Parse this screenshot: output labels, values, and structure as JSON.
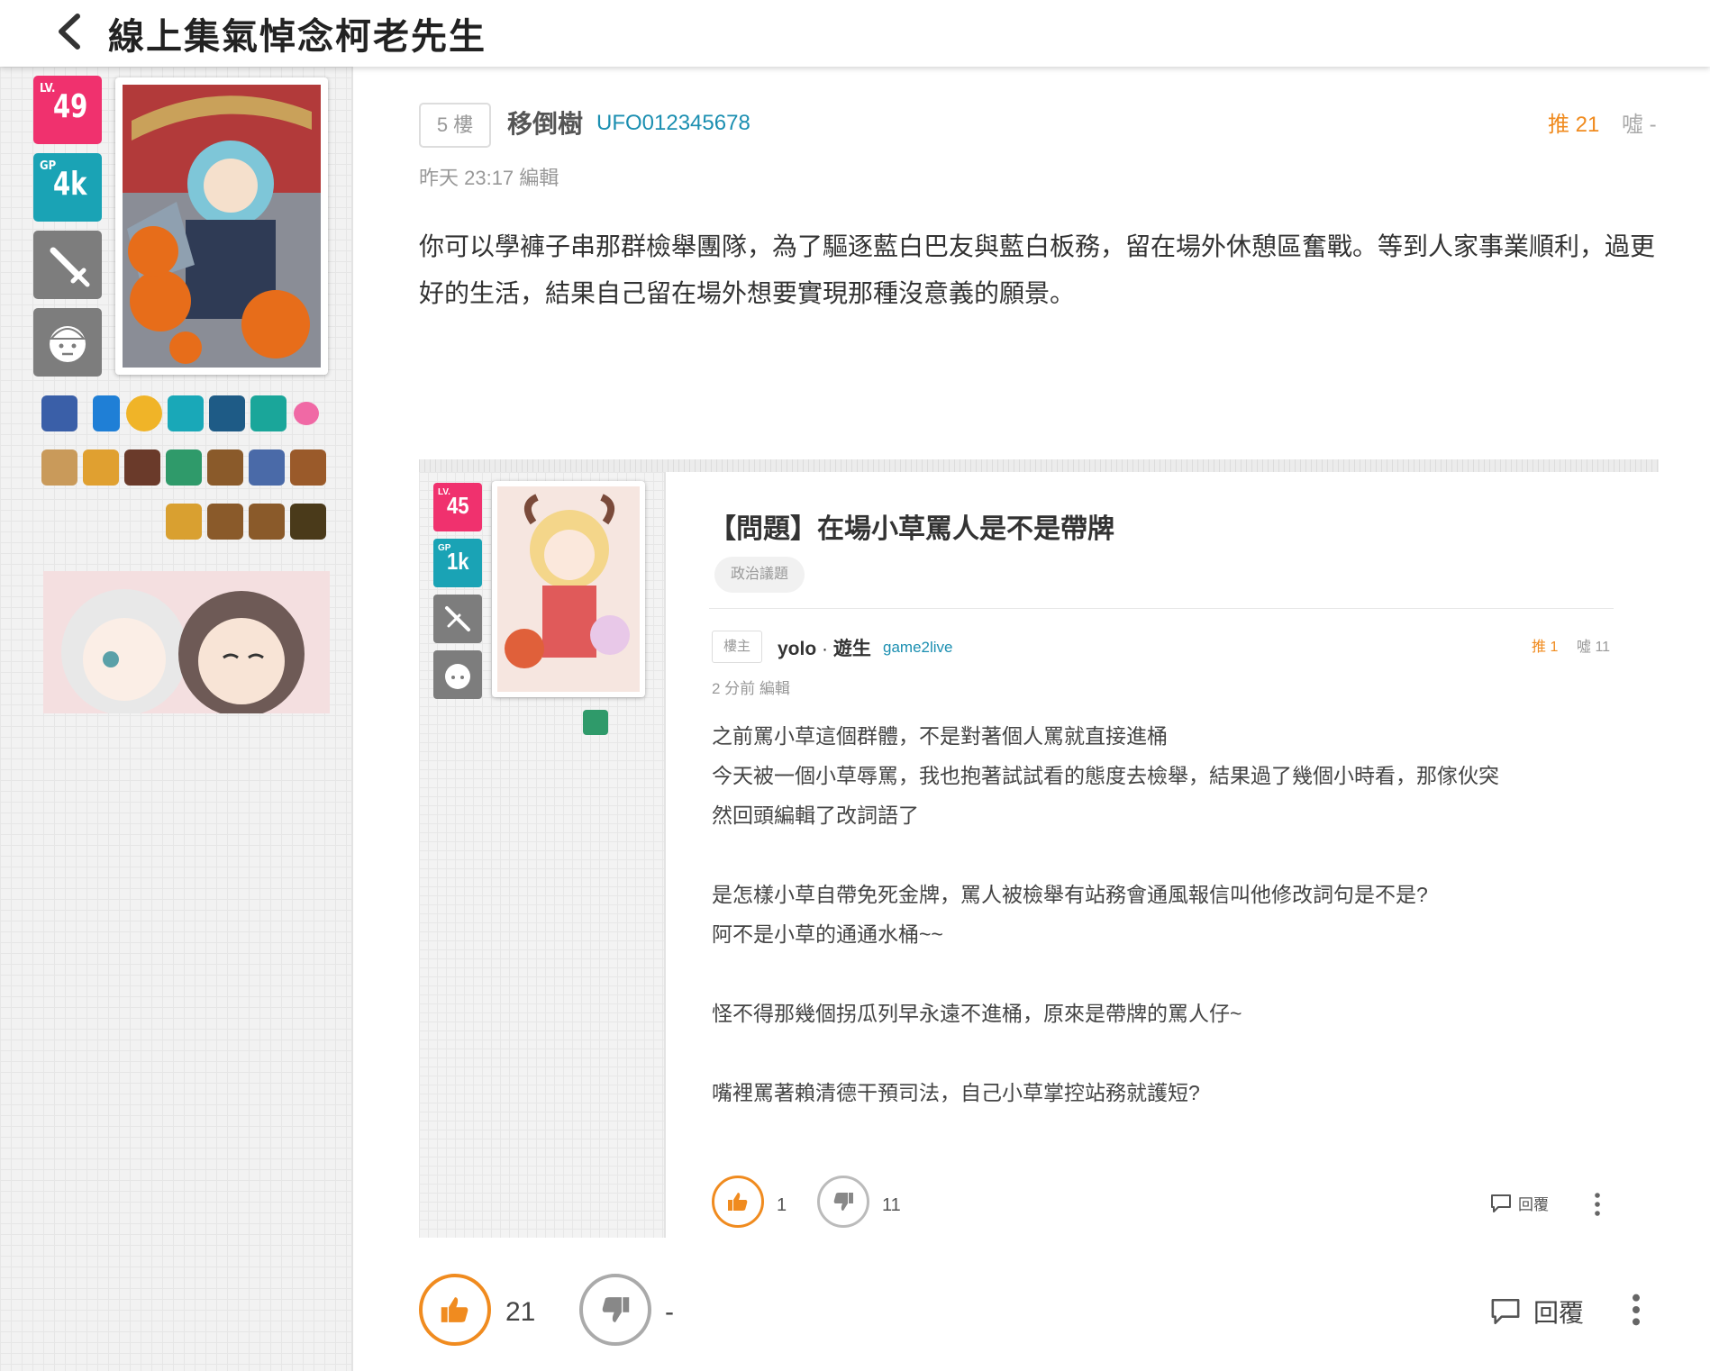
{
  "header": {
    "title": "線上集氣悼念柯老先生"
  },
  "sidebar": {
    "level": {
      "label": "LV.",
      "value": "49"
    },
    "gp": {
      "label": "GP",
      "value": "4k"
    }
  },
  "post": {
    "floor": "5 樓",
    "author": "移倒樹",
    "user_id": "UFO012345678",
    "push": "推 21",
    "boo": "噓 -",
    "meta": "昨天 23:17 編輯",
    "body": "你可以學褲子串那群檢舉團隊，為了驅逐藍白巴友與藍白板務，留在場外休憩區奮戰。等到人家事業順利，過更好的生活，結果自己留在場外想要實現那種沒意義的願景。",
    "like_count": "21",
    "dislike_count": "-",
    "reply_label": "回覆"
  },
  "quote": {
    "level": {
      "label": "LV.",
      "value": "45"
    },
    "gp": {
      "label": "GP",
      "value": "1k"
    },
    "title": "【問題】在場小草罵人是不是帶牌",
    "chip": "政治議題",
    "floor": "樓主",
    "author_name": "yolo",
    "author_sep": " · ",
    "author_nick": "遊生",
    "user_id": "game2live",
    "push": "推 1",
    "boo": "噓 11",
    "meta": "2 分前 編輯",
    "lines": [
      "之前罵小草這個群體，不是對著個人罵就直接進桶",
      "今天被一個小草辱罵，我也抱著試試看的態度去檢舉，結果過了幾個小時看，那傢伙突",
      "然回頭編輯了改詞語了",
      "",
      "是怎樣小草自帶免死金牌，罵人被檢舉有站務會通風報信叫他修改詞句是不是?",
      "阿不是小草的通通水桶~~",
      "",
      "怪不得那幾個拐瓜列早永遠不進桶，原來是帶牌的罵人仔~",
      "",
      "嘴裡罵著賴清德干預司法，自己小草掌控站務就護短?"
    ],
    "like_count": "1",
    "dislike_count": "11",
    "reply_label": "回覆"
  },
  "colors": {
    "accent": "#f08b1f",
    "level": "#f0316e",
    "gp": "#1aa3b5",
    "link": "#1b8fb1"
  }
}
